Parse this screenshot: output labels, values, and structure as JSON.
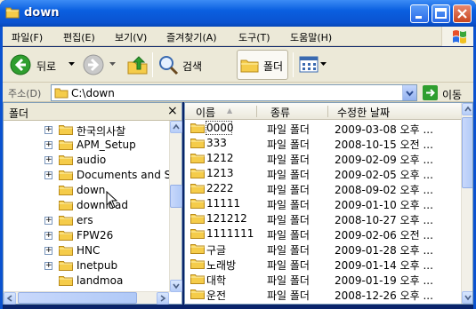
{
  "window": {
    "title": "down"
  },
  "menu": {
    "items": [
      "파일(F)",
      "편집(E)",
      "보기(V)",
      "즐겨찾기(A)",
      "도구(T)",
      "도움말(H)"
    ]
  },
  "toolbar": {
    "back_label": "뒤로",
    "search_label": "검색",
    "folders_label": "폴더"
  },
  "address": {
    "label": "주소(D)",
    "value": "C:\\down",
    "go_label": "이동"
  },
  "folder_panel": {
    "title": "폴더",
    "close_glyph": "×",
    "items": [
      {
        "label": "한국의사찰",
        "expander": "+"
      },
      {
        "label": "APM_Setup",
        "expander": "+"
      },
      {
        "label": "audio",
        "expander": "+"
      },
      {
        "label": "Documents and S",
        "expander": "+"
      },
      {
        "label": "down",
        "expander": ""
      },
      {
        "label": "download",
        "expander": ""
      },
      {
        "label": "ers",
        "expander": "+"
      },
      {
        "label": "FPW26",
        "expander": "+"
      },
      {
        "label": "HNC",
        "expander": "+"
      },
      {
        "label": "Inetpub",
        "expander": "+"
      },
      {
        "label": "landmoa",
        "expander": ""
      }
    ]
  },
  "file_list": {
    "columns": [
      "이름",
      "종류",
      "수정한 날짜"
    ],
    "sort_indicator": "▲",
    "rows": [
      {
        "name": "0000",
        "type": "파일 폴더",
        "date": "2009-03-08 오후 ..."
      },
      {
        "name": "333",
        "type": "파일 폴더",
        "date": "2008-10-15 오전 ..."
      },
      {
        "name": "1212",
        "type": "파일 폴더",
        "date": "2009-02-09 오후 ..."
      },
      {
        "name": "1213",
        "type": "파일 폴더",
        "date": "2009-02-05 오후 ..."
      },
      {
        "name": "2222",
        "type": "파일 폴더",
        "date": "2008-09-02 오후 ..."
      },
      {
        "name": "11111",
        "type": "파일 폴더",
        "date": "2009-01-10 오후 ..."
      },
      {
        "name": "121212",
        "type": "파일 폴더",
        "date": "2008-10-27 오후 ..."
      },
      {
        "name": "1111111",
        "type": "파일 폴더",
        "date": "2009-02-06 오전 ..."
      },
      {
        "name": "구글",
        "type": "파일 폴더",
        "date": "2009-01-28 오후 ..."
      },
      {
        "name": "노래방",
        "type": "파일 폴더",
        "date": "2009-01-14 오후 ..."
      },
      {
        "name": "대학",
        "type": "파일 폴더",
        "date": "2009-01-19 오후 ..."
      },
      {
        "name": "운전",
        "type": "파일 폴더",
        "date": "2008-12-26 오후 ..."
      }
    ]
  },
  "colors": {
    "titlebar": "#0a52d0",
    "folder_yellow": "#f5cc4a",
    "back_green": "#2f9e2f",
    "window_bg": "#ece9d8"
  }
}
